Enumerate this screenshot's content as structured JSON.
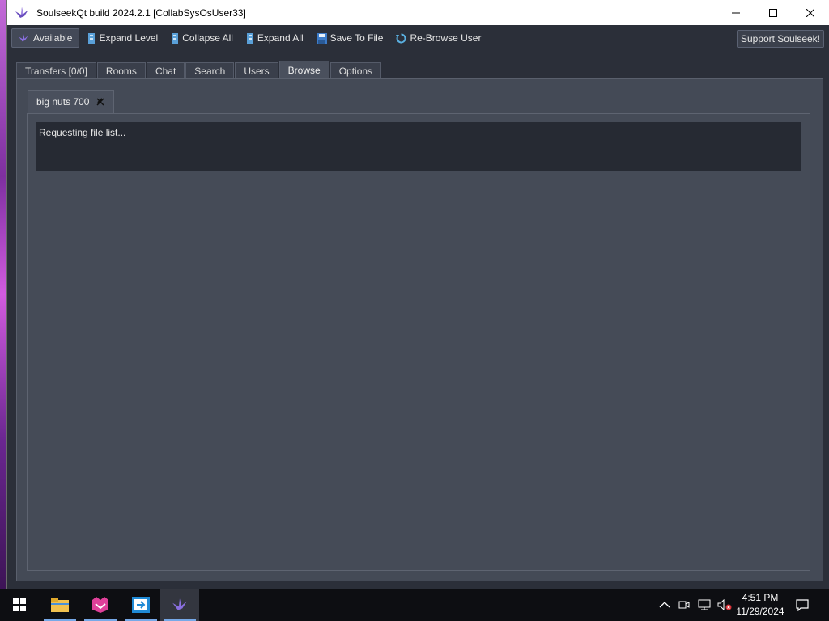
{
  "window": {
    "title": "SoulseekQt build 2024.2.1 [CollabSysOsUser33]"
  },
  "toolbar": {
    "status_label": "Available",
    "expand_level": "Expand Level",
    "collapse_all": "Collapse All",
    "expand_all": "Expand All",
    "save_to_file": "Save To File",
    "re_browse_user": "Re-Browse User",
    "support": "Support Soulseek!"
  },
  "tabs": [
    {
      "label": "Transfers [0/0]"
    },
    {
      "label": "Rooms"
    },
    {
      "label": "Chat"
    },
    {
      "label": "Search"
    },
    {
      "label": "Users"
    },
    {
      "label": "Browse",
      "active": true
    },
    {
      "label": "Options"
    }
  ],
  "browse": {
    "user_tab": "big nuts 700",
    "status_text": "Requesting file list..."
  },
  "taskbar": {
    "time": "4:51 PM",
    "date": "11/29/2024"
  },
  "colors": {
    "accent": "#76a9e8",
    "panel": "#444a56",
    "toolbar": "#2b2f39"
  }
}
